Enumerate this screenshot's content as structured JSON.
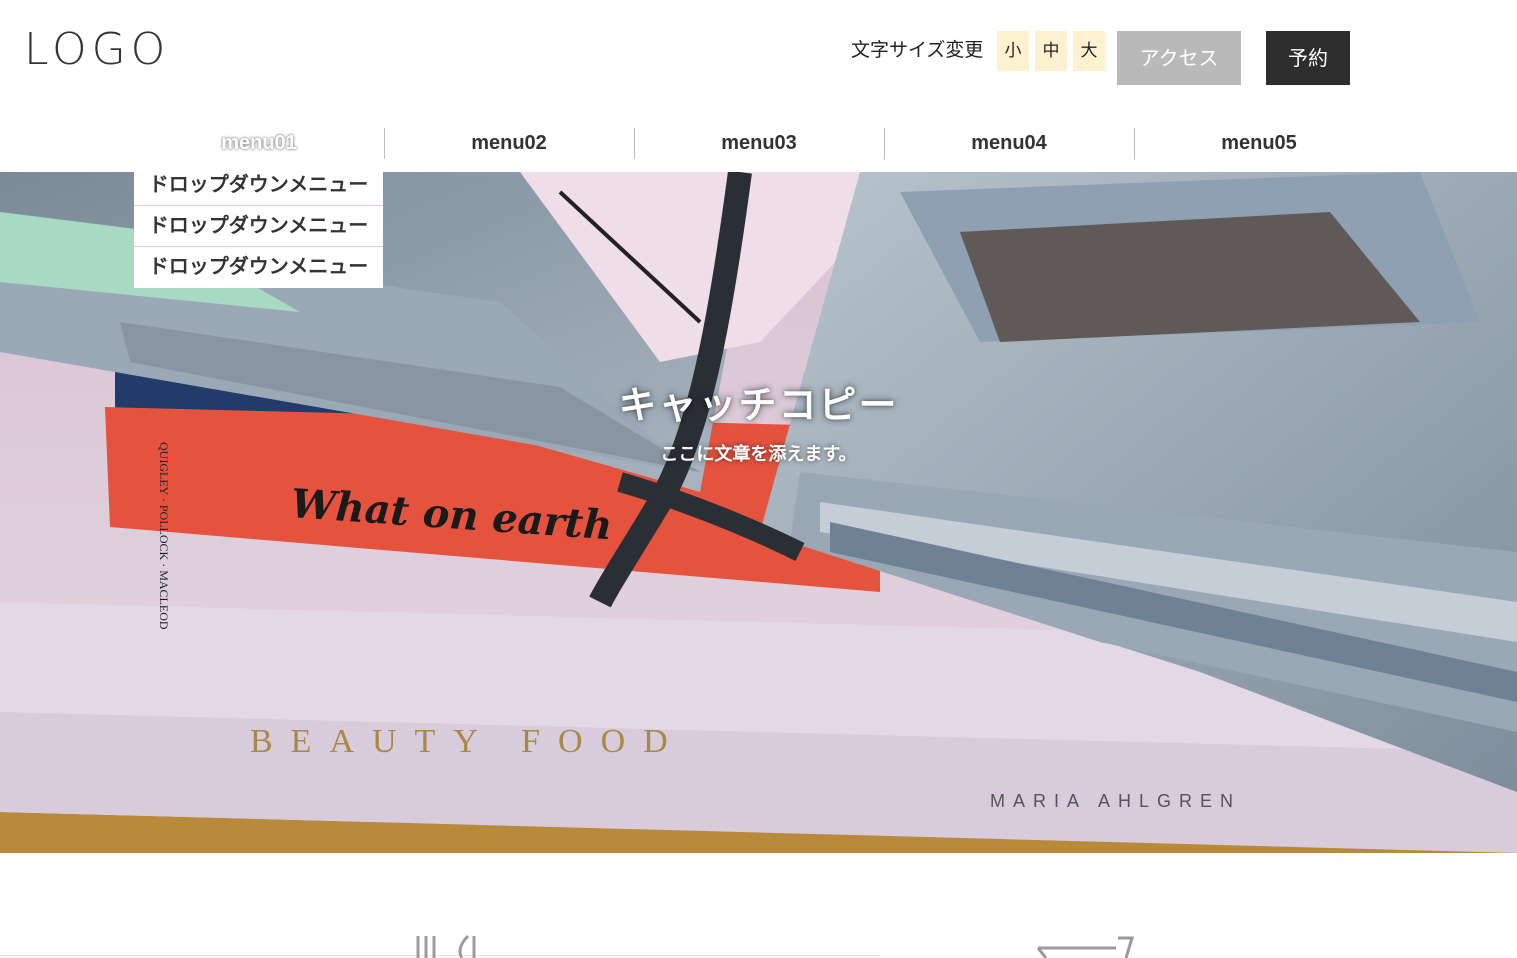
{
  "header": {
    "logo": "LOGO",
    "font_size_label": "文字サイズ変更",
    "font_sizes": [
      "小",
      "中",
      "大"
    ],
    "access_label": "アクセス",
    "reserve_label": "予約"
  },
  "nav": {
    "items": [
      "menu01",
      "menu02",
      "menu03",
      "menu04",
      "menu05"
    ],
    "active_index": 0,
    "dropdown": [
      "ドロップダウンメニュー",
      "ドロップダウンメニュー",
      "ドロップダウンメニュー"
    ]
  },
  "hero": {
    "catch_copy": "キャッチコピー",
    "sub_copy": "ここに文章を添えます。",
    "image_text": {
      "orange_book": "What on earth",
      "authors": "QUIGLEY · POLLOCK · MACLEOD",
      "bottom_book_title": "BEAUTY FOOD",
      "bottom_book_author": "MARIA AHLGREN"
    }
  },
  "section": {
    "icons": [
      "fork-knife-icon",
      "cart-icon"
    ]
  },
  "colors": {
    "font_size_bg": "#fdf1d0",
    "access_bg": "#b9b9b9",
    "reserve_bg": "#2d2d2d",
    "dropdown_divider": "#f0c6c9"
  }
}
